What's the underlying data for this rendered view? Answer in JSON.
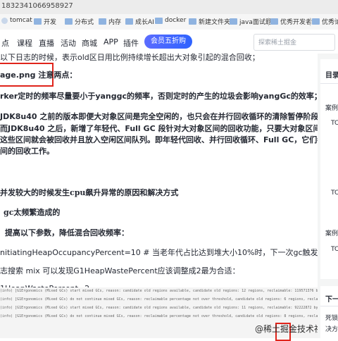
{
  "browser": {
    "url": "1832341066958927",
    "bookmarks": [
      "tomcat",
      "开发",
      "分布式",
      "内存",
      "成长AI",
      "docker",
      "新建文件夹",
      "java面试题",
      "优秀开发者",
      "优秀论文"
    ]
  },
  "site": {
    "nav": [
      "点",
      "课程",
      "直播",
      "活动",
      "商城",
      "APP",
      "插件"
    ],
    "promo": "会员五折购",
    "search_placeholder": "探索稀土掘金"
  },
  "article": {
    "lines": [
      "以下日志的时候，表示old区日用比例持续增长超出大对象引起的混合回收；",
      "age.png 注意两点：",
      "rker定时的频率尽量要小于yanggc的频率，否则定时的产生的垃圾会影响yangGc的效率；",
      "JDK8u40 之前的版本即便大对象区间是完全空闲的，也只会在并行回收循环的清除暂停阶段才会回收大对",
      "而JDK8u40 之后，新增了年轻代、Full GC 段针对大对象区间的回收功能，只要大对象区间不再包含任何引",
      "这些区间就会被回收并且放入空闲区间队列。即年轻代回收、并行回收循环、Full GC，它们都会参与到大对",
      "间的回收工作。",
      "并发较大的时候发生cpu飙升异常的原因和解决方式",
      "gc太频繁造成的",
      "提高以下参数，降低混合回收频率：",
      "nitiatingHeapOccupancyPercent=10  # 当老年代占比达到堆大小10%时，下一次gc触发混合回收；",
      "志搜索 mix  可以发现G1HeapWastePercent应该调整成2最为合适：",
      "1HeapWastePercent=2"
    ],
    "logs": [
      "(info) [G1Ergonomics (Mixed GCs) start mixed GCs, reason: candidate old regions available, candidate old regions: 12 regions, reclaimable: 119571376 bytes (5.86 %), threshold: 1.00 %]",
      "(info) [G1Ergonomics (Mixed GCs) do not continue mixed GCs, reason: reclaimable percentage not over threshold, candidate old regions: 6 regions, reclaimable: 81729688 bytes (0.98 %), threshold: 1.00 %]",
      "(info) [G1Ergonomics (Mixed GCs) start mixed GCs, reason: candidate old regions available, candidate old regions: 11 regions, reclaimable: 92222872 bytes (1.43 %), threshold: 1.00 %]",
      "(info) [G1Ergonomics (Mixed GCs) do not continue mixed GCs, reason: reclaimable percentage not over threshold, candidate old regions: 8 regions, reclaimable: 65575312 bytes (0.99 %), threshold: 1.00 %]"
    ]
  },
  "sidebar": {
    "toc_title": "目录",
    "items": [
      "案例",
      "TC",
      "TC",
      "案例",
      "TC"
    ],
    "next_title": "下一",
    "next_items": [
      "死锁",
      "决方"
    ]
  },
  "watermark": "@稀土掘金技术社区",
  "colors": {
    "highlight_border": "#e0241b",
    "promo_bg": "#2e63ff"
  }
}
